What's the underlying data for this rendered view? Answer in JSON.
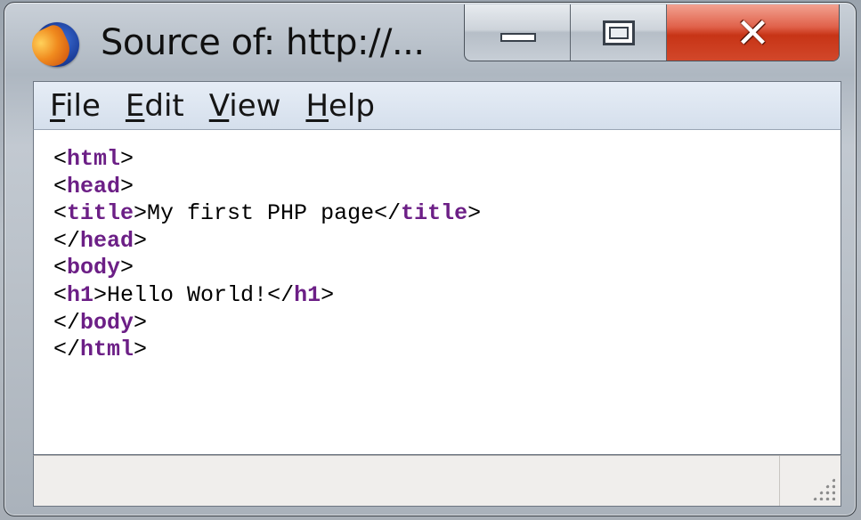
{
  "window": {
    "title": "Source of: http://..."
  },
  "menu": {
    "items": [
      {
        "label": "File",
        "mnemonic": "F",
        "rest": "ile"
      },
      {
        "label": "Edit",
        "mnemonic": "E",
        "rest": "dit"
      },
      {
        "label": "View",
        "mnemonic": "V",
        "rest": "iew"
      },
      {
        "label": "Help",
        "mnemonic": "H",
        "rest": "elp"
      }
    ]
  },
  "source": {
    "lines": [
      [
        {
          "t": "p",
          "v": "<"
        },
        {
          "t": "tag",
          "v": "html"
        },
        {
          "t": "p",
          "v": ">"
        }
      ],
      [
        {
          "t": "p",
          "v": "<"
        },
        {
          "t": "tag",
          "v": "head"
        },
        {
          "t": "p",
          "v": ">"
        }
      ],
      [
        {
          "t": "p",
          "v": "<"
        },
        {
          "t": "tag",
          "v": "title"
        },
        {
          "t": "p",
          "v": ">My first PHP page</"
        },
        {
          "t": "tag",
          "v": "title"
        },
        {
          "t": "p",
          "v": ">"
        }
      ],
      [
        {
          "t": "p",
          "v": "</"
        },
        {
          "t": "tag",
          "v": "head"
        },
        {
          "t": "p",
          "v": ">"
        }
      ],
      [
        {
          "t": "p",
          "v": "<"
        },
        {
          "t": "tag",
          "v": "body"
        },
        {
          "t": "p",
          "v": ">"
        }
      ],
      [
        {
          "t": "p",
          "v": "<"
        },
        {
          "t": "tag",
          "v": "h1"
        },
        {
          "t": "p",
          "v": ">Hello World!</"
        },
        {
          "t": "tag",
          "v": "h1"
        },
        {
          "t": "p",
          "v": ">"
        }
      ],
      [
        {
          "t": "p",
          "v": "</"
        },
        {
          "t": "tag",
          "v": "body"
        },
        {
          "t": "p",
          "v": ">"
        }
      ],
      [
        {
          "t": "p",
          "v": "</"
        },
        {
          "t": "tag",
          "v": "html"
        },
        {
          "t": "p",
          "v": ">"
        }
      ]
    ]
  },
  "icons": {
    "app": "firefox-icon",
    "minimize": "minimize-icon",
    "maximize": "maximize-icon",
    "close": "close-icon",
    "resize": "resize-grip-icon"
  },
  "colors": {
    "tag": "#6c1f86",
    "close_button": "#c73416"
  }
}
